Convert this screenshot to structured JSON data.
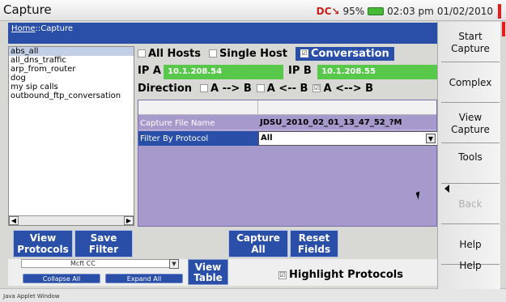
{
  "window": {
    "title": "Capture"
  },
  "status": {
    "battery": "95%",
    "time": "02:03 pm",
    "date": "01/02/2010",
    "network_icon": "network-connection-icon",
    "battery_icon": "battery-icon"
  },
  "breadcrumb": {
    "home": "Home",
    "separator": "::",
    "current": "Capture"
  },
  "filters": {
    "items": [
      "abs_all",
      "all_dns_traffic",
      "arp_from_router",
      "dog",
      "my sip calls",
      "outbound_ftp_conversation"
    ],
    "selected_index": 0
  },
  "mode": {
    "all_hosts": "All Hosts",
    "single_host": "Single Host",
    "conversation": "Conversation",
    "selected": "Conversation"
  },
  "ip": {
    "a_label": "IP A",
    "a_value": "10.1.208.54",
    "b_label": "IP B",
    "b_value": "10.1.208.55"
  },
  "direction": {
    "label": "Direction",
    "opt1": "A --> B",
    "opt2": "A <-- B",
    "opt3": "A <--> B",
    "selected": "A <--> B"
  },
  "table": {
    "rows": [
      {
        "key": "Capture File Name",
        "value": "JDSU_2010_02_01_13_47_52_?M"
      },
      {
        "key": "Filter By Protocol",
        "value": "All"
      }
    ]
  },
  "buttons": {
    "view_protocols": [
      "View",
      "Protocols"
    ],
    "save_filter": [
      "Save",
      "Filter"
    ],
    "capture_all": [
      "Capture",
      "All"
    ],
    "reset_fields": [
      "Reset",
      "Fields"
    ]
  },
  "under": {
    "scroll_text": "Mcft CC",
    "collapse_all": "Collapse All",
    "expand_all": "Expand All",
    "view_table": [
      "View",
      "Table"
    ],
    "highlight_protocols": "Highlight Protocols"
  },
  "sidebar": {
    "start_capture": [
      "Start",
      "Capture"
    ],
    "complex": "Complex",
    "view_capture": [
      "View",
      "Capture"
    ],
    "tools": "Tools",
    "back": "Back",
    "help": "Help",
    "help2": "Help"
  },
  "footer": {
    "text": "Java Applet Window"
  },
  "colors": {
    "accent": "#2a4fa8",
    "ip_green": "#58c84a",
    "table_purple": "#a699cc"
  }
}
